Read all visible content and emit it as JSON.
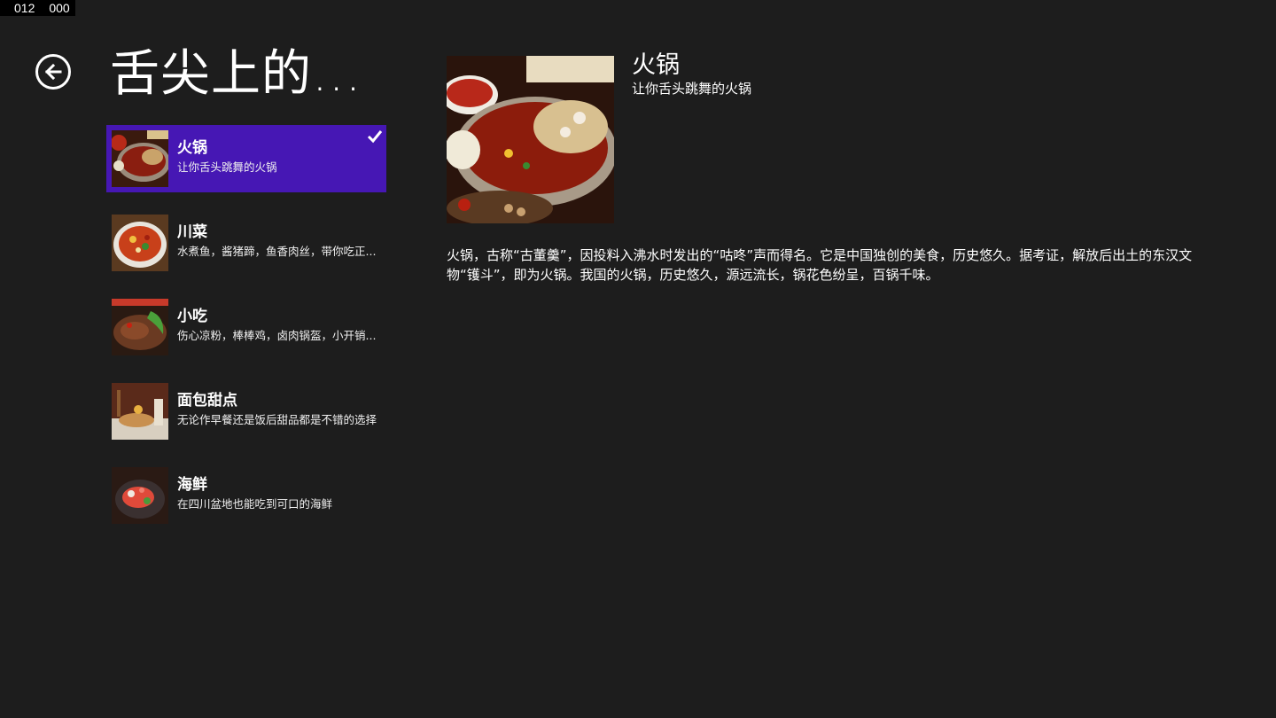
{
  "frame_counter": {
    "left": "012",
    "right": "000"
  },
  "header": {
    "title": "舌尖上的..."
  },
  "categories": [
    {
      "title": "火锅",
      "subtitle": "让你舌头跳舞的火锅",
      "selected": true
    },
    {
      "title": "川菜",
      "subtitle": "水煮鱼，酱猪蹄，鱼香肉丝，带你吃正...",
      "selected": false
    },
    {
      "title": "小吃",
      "subtitle": "伤心凉粉，棒棒鸡，卤肉锅盔，小开销...",
      "selected": false
    },
    {
      "title": "面包甜点",
      "subtitle": "无论作早餐还是饭后甜品都是不错的选择",
      "selected": false
    },
    {
      "title": "海鲜",
      "subtitle": "在四川盆地也能吃到可口的海鲜",
      "selected": false
    }
  ],
  "detail": {
    "title": "火锅",
    "subtitle": "让你舌头跳舞的火锅",
    "description": "火锅，古称“古董羹”，因投料入沸水时发出的“咕咚”声而得名。它是中国独创的美食，历史悠久。据考证，解放后出土的东汉文物“镬斗”，即为火锅。我国的火锅，历史悠久，源远流长，锅花色纷呈，百锅千味。"
  },
  "colors": {
    "background": "#1d1d1d",
    "selected_item": "#4617b4",
    "text": "#ffffff"
  }
}
